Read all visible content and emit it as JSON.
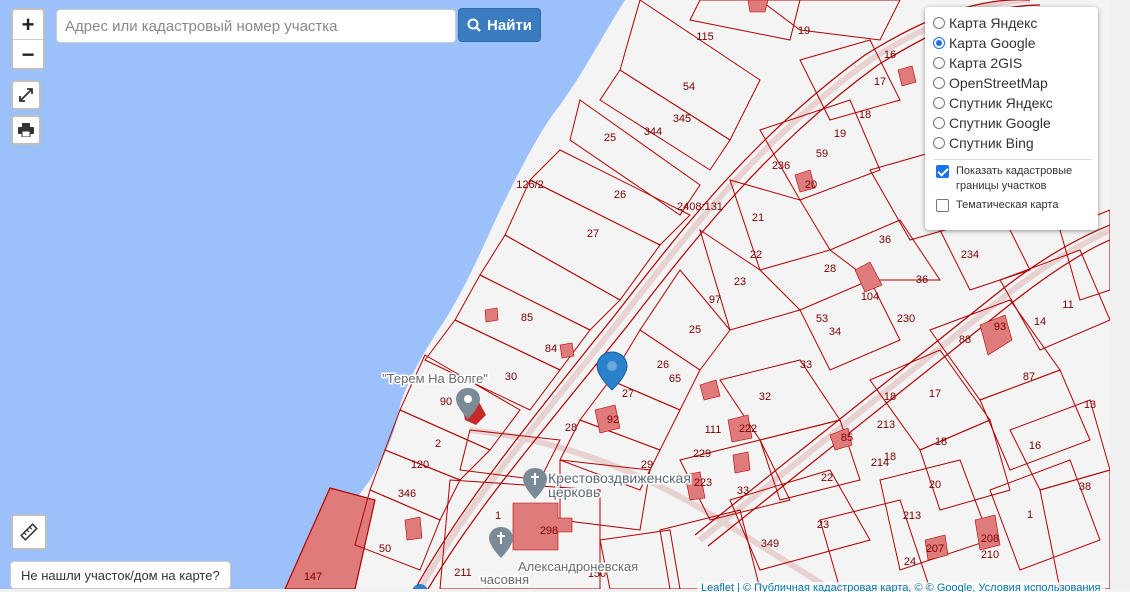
{
  "search": {
    "placeholder": "Адрес или кадастровый номер участка",
    "button_label": "Найти"
  },
  "zoom": {
    "in_label": "+",
    "out_label": "−"
  },
  "layers": {
    "options": [
      {
        "label": "Карта Яндекс",
        "selected": false
      },
      {
        "label": "Карта Google",
        "selected": true
      },
      {
        "label": "Карта 2GIS",
        "selected": false
      },
      {
        "label": "OpenStreetMap",
        "selected": false
      },
      {
        "label": "Спутник Яндекс",
        "selected": false
      },
      {
        "label": "Спутник Google",
        "selected": false
      },
      {
        "label": "Спутник Bing",
        "selected": false
      }
    ],
    "checkboxes": [
      {
        "label": "Показать кадастровые границы участков",
        "checked": true
      },
      {
        "label": "Тематическая карта",
        "checked": false
      }
    ]
  },
  "not_found_label": "Не нашли участок/дом на карте?",
  "attribution": {
    "text": "Leaflet | © Публичная кадастровая карта, © © Google, Условия использования"
  },
  "poi": {
    "terem": "\"Терем На Волге\"",
    "church": "Крестовоздвиженская церковь",
    "chapel": "Александроневская часовня"
  },
  "parcel_labels": [
    "115",
    "19",
    "16",
    "17",
    "54",
    "345",
    "18",
    "344",
    "25",
    "19",
    "59",
    "236",
    "20",
    "126/2",
    "26",
    "21",
    "36",
    "27",
    "22",
    "234",
    "2408:131",
    "28",
    "23",
    "230",
    "104",
    "36",
    "11",
    "85",
    "97",
    "53",
    "34",
    "14",
    "84",
    "25",
    "88",
    "93",
    "30",
    "26",
    "65",
    "33",
    "87",
    "90",
    "27",
    "32",
    "18",
    "17",
    "13",
    "92",
    "111",
    "222",
    "2",
    "28",
    "229",
    "85",
    "213",
    "18",
    "16",
    "29",
    "18",
    "120",
    "223",
    "22",
    "214",
    "1",
    "20",
    "346",
    "33",
    "38",
    "298",
    "1",
    "23",
    "213",
    "50",
    "349",
    "24",
    "207",
    "208",
    "210",
    "211",
    "150",
    "147",
    "181"
  ],
  "colors": {
    "water": "#9cc0f9",
    "parcel_line": "#b40000",
    "building": "#e07b7b",
    "accent": "#3a7cbf",
    "marker": "#2b82cb"
  }
}
